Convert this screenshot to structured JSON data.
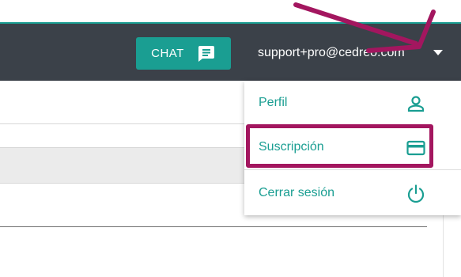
{
  "header": {
    "chat_label": "CHAT",
    "chat_icon": "chat-bubble-icon",
    "user_email": "support+pro@cedreo.com",
    "dropdown_icon": "caret-down-icon"
  },
  "menu": {
    "items": [
      {
        "label": "Perfil",
        "icon": "person-icon"
      },
      {
        "label": "Suscripción",
        "icon": "credit-card-icon"
      },
      {
        "label": "Cerrar sesión",
        "icon": "power-icon"
      }
    ]
  },
  "colors": {
    "header_bg": "#3b4149",
    "accent_teal": "#1a9e92",
    "annotation_magenta": "#a3165f"
  }
}
